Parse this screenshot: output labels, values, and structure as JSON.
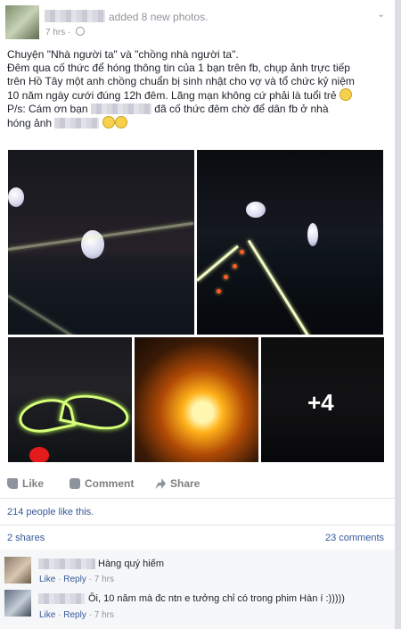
{
  "post": {
    "action_text": "added 8 new photos.",
    "time": "7 hrs",
    "privacy_separator": "·",
    "lines": [
      "Chuyện \"Nhà người ta\" và \"chồng nhà người ta\".",
      "Đêm qua cố thức để hóng thông tin của 1 bạn trên fb, chụp ảnh trực tiếp",
      "trên Hồ Tây một anh chồng chuẩn bị sinh nhật cho vợ và tổ chức kỷ niệm",
      "10 năm ngày cưới đúng 12h đêm. Lãng mạn không cứ phải là tuổi trẻ"
    ],
    "ps_prefix": "P/s: Cám ơn bạn",
    "ps_middle": "đã cố thức đêm chờ để dân fb ở nhà",
    "ps_end": "hóng ảnh"
  },
  "photos": {
    "more_label": "+4"
  },
  "actions": {
    "like_label": "Like",
    "comment_label": "Comment",
    "share_label": "Share"
  },
  "stats": {
    "likes_text": "214 people like this.",
    "shares_text": "2 shares",
    "comments_text": "23 comments"
  },
  "comments": [
    {
      "text": "Hàng quý hiếm",
      "like": "Like",
      "reply": "Reply",
      "sep": "·",
      "time": "7 hrs"
    },
    {
      "text": "Ôi, 10 năm mà đc ntn e tưởng chỉ có trong phim Hàn í :)))))",
      "like": "Like",
      "reply": "Reply",
      "sep": "·",
      "time": "7 hrs"
    }
  ]
}
